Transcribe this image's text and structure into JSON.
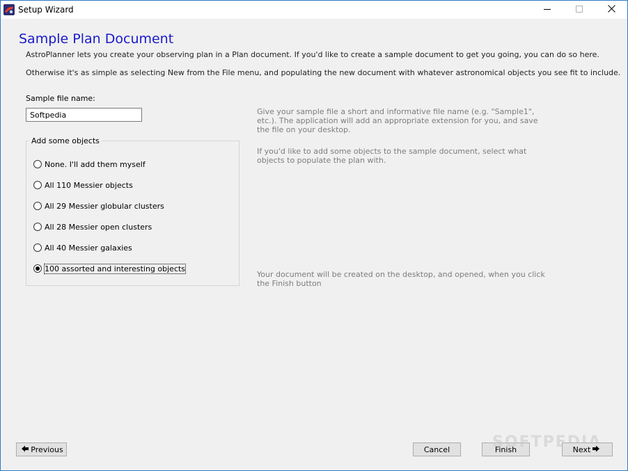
{
  "window": {
    "title": "Setup Wizard"
  },
  "page": {
    "title": "Sample Plan Document",
    "intro_1": "AstroPlanner lets you create your observing plan in a Plan document. If you'd like to create a sample document to get you going, you can do so here.",
    "intro_2": "Otherwise it's as simple as selecting New from the File menu, and populating the new document with whatever astronomical objects you see fit to include."
  },
  "file": {
    "label": "Sample file name:",
    "value": "Softpedia"
  },
  "objects": {
    "group_label": "Add some objects",
    "options": [
      {
        "label": "None. I'll add them myself",
        "selected": false
      },
      {
        "label": "All 110 Messier objects",
        "selected": false
      },
      {
        "label": "All 29 Messier globular clusters",
        "selected": false
      },
      {
        "label": "All 28 Messier open clusters",
        "selected": false
      },
      {
        "label": "All 40 Messier galaxies",
        "selected": false
      },
      {
        "label": "100 assorted and interesting objects",
        "selected": true
      }
    ]
  },
  "help": {
    "file_name": "Give your sample file a short and informative file name (e.g. \"Sample1\", etc.). The application will add an appropriate extension for you, and save the file on your desktop.",
    "objects": "If you'd like to add some objects to the sample document, select what objects to populate the plan with.",
    "finish": "Your document will be created on the desktop, and opened, when you click the Finish button"
  },
  "buttons": {
    "previous": "Previous",
    "cancel": "Cancel",
    "finish": "Finish",
    "next": "Next"
  },
  "watermark": "SOFTPEDIA",
  "colors": {
    "title_blue": "#1a1acc",
    "help_gray": "#7d7d7d",
    "window_border": "#2b79c5"
  }
}
